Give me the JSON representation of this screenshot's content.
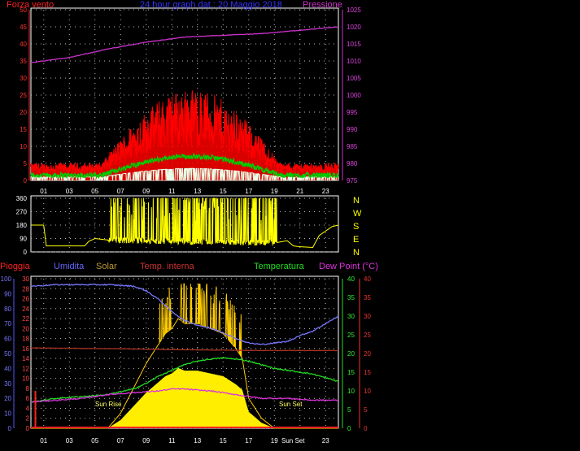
{
  "header": {
    "left": "Forza vento",
    "center": "24 hour graph dat.: 20 Maggio 2018",
    "right": "Pressione"
  },
  "legend2": {
    "pioggia": "Pioggia",
    "umidita": "Umidita",
    "solar": "Solar",
    "temp_interna": "Temp. interna",
    "temperatura": "Temperatura",
    "dew_point": "Dew Point (°C)"
  },
  "labels": {
    "sun_rise": "Sun Rise",
    "sun_set": "Sun Set",
    "sun_set_axis": "Sun Set"
  },
  "direction_labels": [
    "N",
    "W",
    "S",
    "E",
    "N"
  ],
  "colors": {
    "wind_gust": "#ff0000",
    "wind_avg": "#00cc00",
    "wind_low": "#e8ffe8",
    "pressure": "#cc33cc",
    "direction": "#ffff00",
    "humidity": "#7777ff",
    "solar": "#ffcc00",
    "solar_fill": "#ffee00",
    "temp_in": "#aa3322",
    "temperature": "#22dd22",
    "dew": "#dd33dd",
    "rain": "#ff2222",
    "axis_white": "#ffffff"
  },
  "chart_data": [
    {
      "type": "line",
      "name": "wind-pressure",
      "x_ticks": [
        "01",
        "03",
        "05",
        "07",
        "09",
        "11",
        "13",
        "15",
        "17",
        "19",
        "21",
        "23"
      ],
      "xlim": [
        0,
        24
      ],
      "ylim_left": [
        0,
        50
      ],
      "y_ticks_left": [
        "0",
        "5",
        "10",
        "15",
        "20",
        "25",
        "30",
        "35",
        "40",
        "45",
        "50"
      ],
      "ylim_right": [
        975,
        1025
      ],
      "y_ticks_right": [
        "975",
        "980",
        "985",
        "990",
        "995",
        "1000",
        "1005",
        "1010",
        "1015",
        "1020",
        "1025"
      ],
      "pressure": {
        "x": [
          0,
          3,
          6,
          9,
          12,
          15,
          18,
          21,
          24
        ],
        "y": [
          1009.5,
          1011,
          1013.5,
          1015.5,
          1017,
          1017.5,
          1018,
          1019,
          1020
        ]
      }
    },
    {
      "type": "line",
      "name": "wind-direction",
      "xlim": [
        0,
        24
      ],
      "ylim": [
        0,
        360
      ],
      "y_ticks": [
        "0",
        "90",
        "180",
        "270",
        "360"
      ],
      "x_ticks": [
        "01",
        "03",
        "05",
        "07",
        "09",
        "11",
        "13",
        "15",
        "17",
        "19",
        "21",
        "23"
      ],
      "direction": {
        "x": [
          0,
          1,
          1.2,
          2,
          3.5,
          4.2,
          4.5,
          5,
          6,
          19,
          20,
          20.5,
          21,
          22,
          22.5,
          23,
          23.5,
          24
        ],
        "y": [
          180,
          180,
          40,
          40,
          40,
          40,
          70,
          90,
          80,
          60,
          75,
          40,
          35,
          30,
          110,
          140,
          170,
          180
        ]
      }
    },
    {
      "type": "line",
      "name": "weather-lower",
      "x_ticks": [
        "01",
        "03",
        "05",
        "07",
        "09",
        "11",
        "13",
        "15",
        "17",
        "19",
        "21",
        "23"
      ],
      "xlim": [
        0,
        24
      ],
      "y_ticks_humidity": [
        "0",
        "10",
        "20",
        "30",
        "40",
        "50",
        "60",
        "70",
        "80",
        "90",
        "100"
      ],
      "y_ticks_rain": [
        "0",
        "2",
        "4",
        "6",
        "8",
        "10",
        "12",
        "14",
        "16",
        "18",
        "20",
        "22",
        "24",
        "26",
        "28",
        "30"
      ],
      "y_ticks_temp": [
        "0",
        "5",
        "10",
        "15",
        "20",
        "25",
        "30",
        "35",
        "40"
      ],
      "humidity": {
        "x": [
          0,
          2,
          4,
          6,
          8,
          9,
          10,
          11,
          12,
          13,
          14,
          15,
          16,
          17,
          18,
          19,
          20,
          21,
          22,
          23,
          24
        ],
        "y": [
          95,
          96,
          96,
          96,
          95,
          92,
          86,
          78,
          72,
          69,
          67,
          64,
          60,
          57,
          56,
          57,
          58,
          62,
          65,
          70,
          75
        ]
      },
      "temperature": {
        "x": [
          0,
          2,
          4,
          6,
          8,
          9,
          10,
          11,
          12,
          13,
          14,
          15,
          16,
          17,
          18,
          19,
          20,
          21,
          22,
          23,
          24
        ],
        "y": [
          7,
          8,
          8.5,
          9,
          10.5,
          12,
          14,
          15.5,
          17,
          18,
          18.5,
          18.8,
          18.5,
          18,
          17,
          16,
          15.5,
          15,
          14.5,
          13.5,
          12.5
        ]
      },
      "dew_point": {
        "x": [
          0,
          4,
          6,
          8,
          10,
          11,
          12,
          13,
          14,
          15,
          16,
          17,
          18,
          20,
          22,
          24
        ],
        "y": [
          7,
          8,
          9,
          9.5,
          10,
          10.5,
          10.5,
          10.2,
          10,
          9.5,
          9,
          8.5,
          8,
          8,
          7.5,
          7.5
        ]
      },
      "temp_interna": {
        "x": [
          0,
          6,
          12,
          18,
          24
        ],
        "y": [
          21.5,
          21.3,
          21,
          20.8,
          20.8
        ]
      },
      "solar": {
        "x": [
          6,
          7,
          8,
          9,
          10,
          10.5,
          11,
          11.5,
          12,
          13,
          14,
          15,
          16,
          16.5,
          17,
          18,
          19
        ],
        "y": [
          0,
          3,
          8,
          13,
          17,
          19,
          20,
          22,
          21,
          21,
          20,
          19,
          16,
          14,
          6,
          2,
          0
        ]
      },
      "rain": {
        "x": [
          0.35
        ],
        "y": [
          7.5
        ]
      }
    }
  ]
}
